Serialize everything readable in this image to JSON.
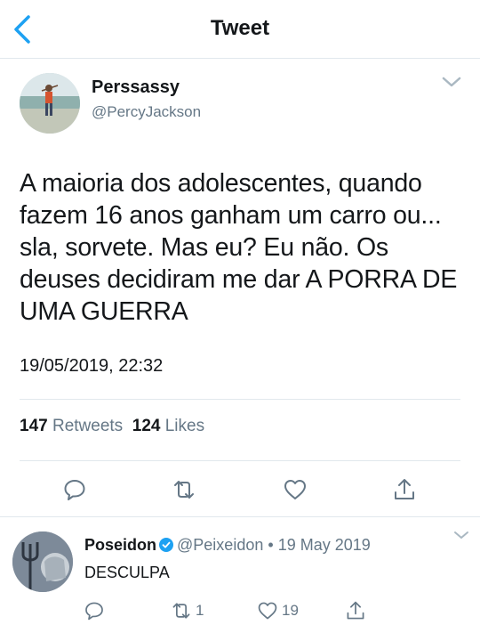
{
  "header": {
    "title": "Tweet",
    "back_icon": "chevron-left-icon",
    "accent": "#1da1f2"
  },
  "tweet": {
    "author_name": "Perssassy",
    "author_handle": "@PercyJackson",
    "text": "A maioria dos adolescentes, quando fazem 16 anos ganham um carro ou... sla, sorvete. Mas eu? Eu não. Os deuses decidiram me dar A PORRA DE UMA GUERRA",
    "timestamp": "19/05/2019, 22:32",
    "stats": {
      "retweets_count": "147",
      "retweets_label": "Retweets",
      "likes_count": "124",
      "likes_label": "Likes"
    },
    "actions": [
      "reply-icon",
      "retweet-icon",
      "like-icon",
      "share-icon"
    ]
  },
  "reply": {
    "author_name": "Poseidon",
    "author_handle": "@Peixeidon",
    "separator": "•",
    "date": "19 May 2019",
    "text": "DESCULPA",
    "retweet_count": "1",
    "like_count": "19"
  }
}
